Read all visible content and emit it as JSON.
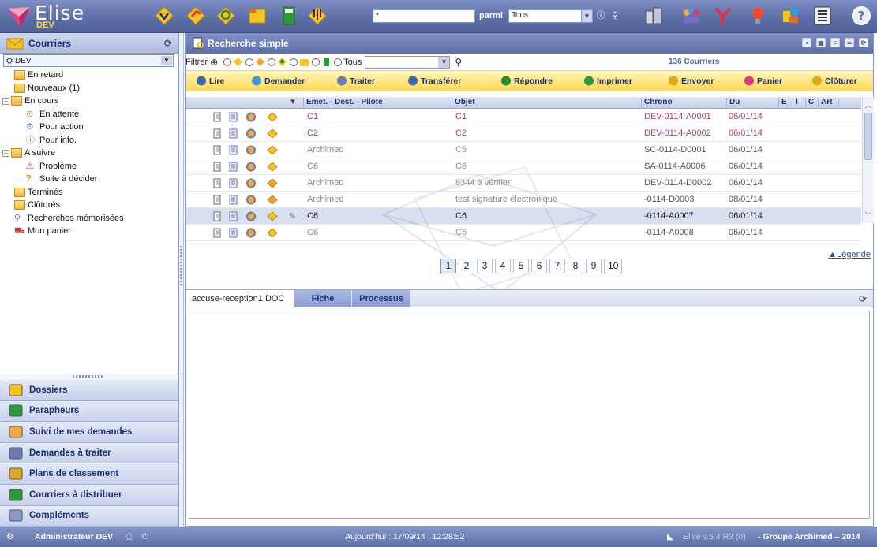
{
  "app": {
    "name": "Elise",
    "env": "DEV"
  },
  "search": {
    "value": "*",
    "scope_label": "parmi",
    "scope_value": "Tous"
  },
  "left": {
    "header": "Courriers",
    "env_select": "DEV",
    "tree": [
      {
        "label": "En retard",
        "level": 1
      },
      {
        "label": "Nouveaux (1)",
        "level": 1
      },
      {
        "label": "En cours",
        "level": 0,
        "toggle": "−"
      },
      {
        "label": "En attente",
        "level": 2
      },
      {
        "label": "Pour action",
        "level": 2
      },
      {
        "label": "Pour info.",
        "level": 2
      },
      {
        "label": "A suivre",
        "level": 0,
        "toggle": "−"
      },
      {
        "label": "Problème",
        "level": 2
      },
      {
        "label": "Suite à décider",
        "level": 2
      },
      {
        "label": "Terminés",
        "level": 1
      },
      {
        "label": "Clôturés",
        "level": 1
      },
      {
        "label": "Recherches mémorisées",
        "level": 1
      },
      {
        "label": "Mon panier",
        "level": 1
      }
    ],
    "modules": [
      "Dossiers",
      "Parapheurs",
      "Suivi de mes demandes",
      "Demandes à traiter",
      "Plans de classement",
      "Courriers à distribuer",
      "Compléments"
    ]
  },
  "main": {
    "title": "Recherche simple",
    "filter_label": "Filtrer",
    "filter_all": "Tous",
    "count": "136 Courriers",
    "actions": [
      "Lire",
      "Demander",
      "Traiter",
      "Transférer",
      "Répondre",
      "Imprimer",
      "Envoyer",
      "Panier",
      "Clôturer"
    ],
    "columns": [
      "Emet. - Dest. - Pilote",
      "Objet",
      "Chrono",
      "Du",
      "E",
      "I",
      "C",
      "AR"
    ],
    "rows": [
      {
        "emet": "C1",
        "objet": "C1",
        "chrono": "DEV-0114-A0001",
        "du": "06/01/14",
        "style": "pink"
      },
      {
        "emet": "C2",
        "objet": "C2",
        "chrono": "DEV-0114-A0002",
        "du": "06/01/14",
        "style": "pink"
      },
      {
        "emet": "Archimed",
        "objet": "C5",
        "chrono": "SC-0114-D0001",
        "du": "06/01/14",
        "style": "grey"
      },
      {
        "emet": "C6",
        "objet": "C6",
        "chrono": "SA-0114-A0006",
        "du": "06/01/14",
        "style": "grey"
      },
      {
        "emet": "Archimed",
        "objet": "8344 à vérifier",
        "chrono": "DEV-0114-D0002",
        "du": "06/01/14",
        "style": "grey"
      },
      {
        "emet": "Archimed",
        "objet": "test signature électronique",
        "chrono": "-0114-D0003",
        "du": "08/01/14",
        "style": "grey"
      },
      {
        "emet": "C6",
        "objet": "C6",
        "chrono": "-0114-A0007",
        "du": "06/01/14",
        "style": "selected"
      },
      {
        "emet": "C6",
        "objet": "C6",
        "chrono": "-0114-A0008",
        "du": "06/01/14",
        "style": "grey"
      }
    ],
    "pages": [
      "1",
      "2",
      "3",
      "4",
      "5",
      "6",
      "7",
      "8",
      "9",
      "10"
    ],
    "legend": "Légende",
    "tabs": [
      "accuse-reception1.DOC",
      "Fiche",
      "Processus"
    ]
  },
  "status": {
    "user": "Administrateur DEV",
    "date": "Aujourd'hui : 17/09/14 , 12:28:52",
    "version": "Elise v.5.4 R3 (0)",
    "company": "- Groupe Archimed – 2014"
  },
  "colors": {
    "header_blue": "#5e70a8",
    "action_yellow": "#ffd95a",
    "row_pink": "#a2427a",
    "row_grey": "#8a8a8a",
    "selected_row": "#d8dfef"
  }
}
